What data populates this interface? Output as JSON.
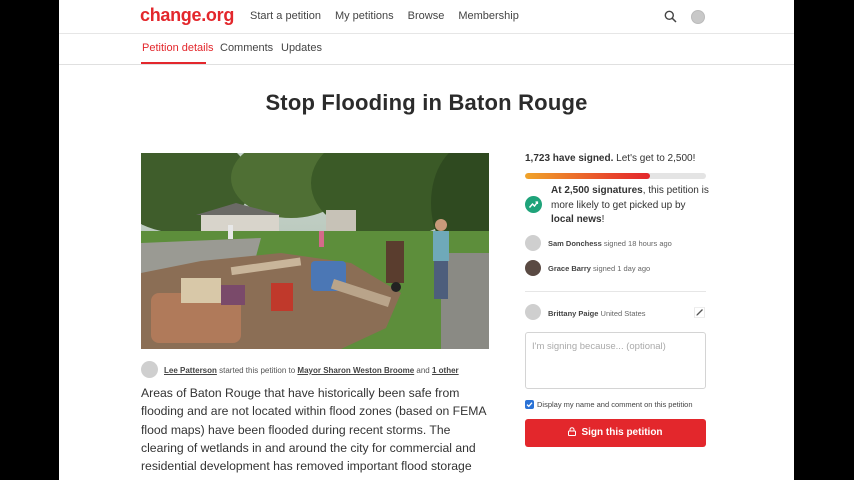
{
  "nav": {
    "logo": "change.org",
    "links": [
      "Start a petition",
      "My petitions",
      "Browse",
      "Membership"
    ]
  },
  "tabs": [
    "Petition details",
    "Comments",
    "Updates"
  ],
  "title": "Stop Flooding in Baton Rouge",
  "starter": {
    "name": "Lee Patterson",
    "mid": " started this petition to ",
    "target": "Mayor Sharon Weston Broome",
    "and": " and ",
    "other": "1 other"
  },
  "body_text": "Areas of Baton Rouge that have historically been safe from flooding and are not located within flood zones (based on FEMA flood maps) have been flooded during recent storms. The clearing of wetlands in and around the city for commercial and residential development has removed important flood storage",
  "sidebar": {
    "signed_count": "1,723 have signed.",
    "goal_text": " Let's get to 2,500!",
    "progress_fraction": 0.69,
    "milestone_bold": "At 2,500 signatures",
    "milestone_text": ", this petition is more likely to get picked up by ",
    "milestone_bold2": "local news",
    "milestone_end": "!",
    "signers": [
      {
        "name": "Sam Donchess",
        "when": " signed 18 hours ago"
      },
      {
        "name": "Grace Barry",
        "when": " signed 1 day ago"
      }
    ],
    "me": {
      "name": "Brittany Paige",
      "country": " United States"
    },
    "reason_placeholder": "I'm signing because... (optional)",
    "display_checkbox_label": "Display my name and comment on this petition",
    "sign_button": "Sign this petition"
  },
  "colors": {
    "brand": "#e3272c",
    "milestone": "#1fa37a",
    "checkbox": "#2a72d6"
  },
  "icons": [
    "search-icon",
    "avatar",
    "trend-up-icon",
    "edit-icon",
    "lock-icon",
    "check-icon"
  ]
}
